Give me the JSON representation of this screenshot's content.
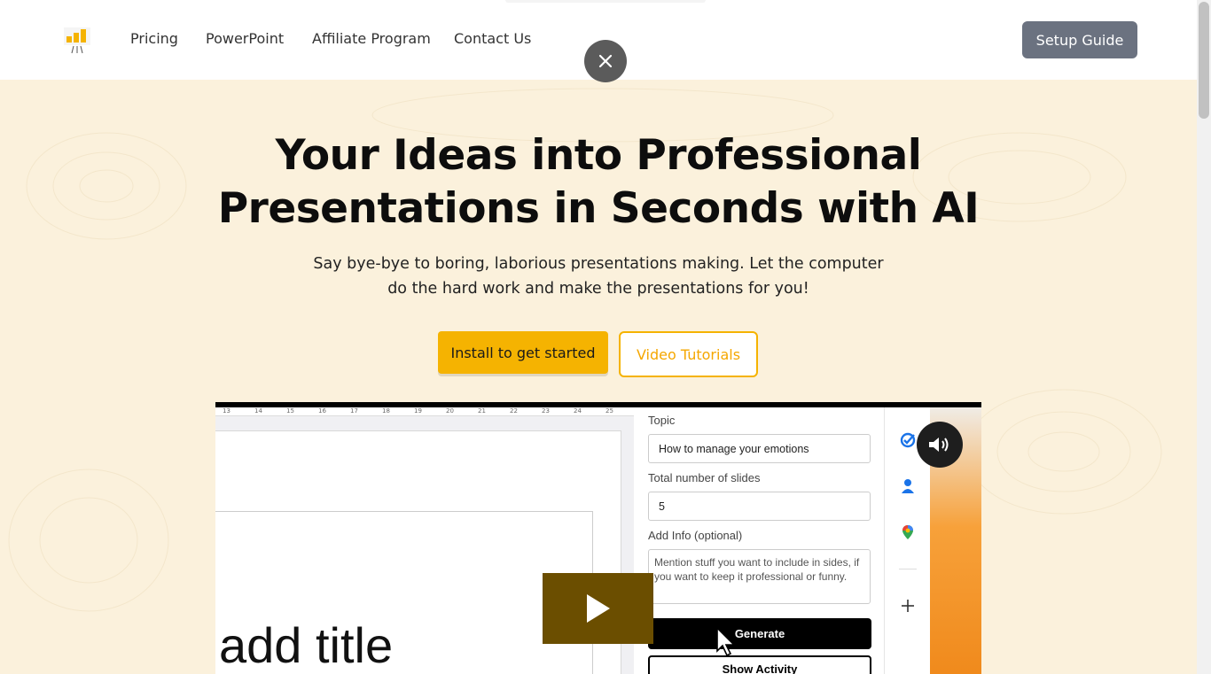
{
  "nav": {
    "items": [
      {
        "label": "Pricing"
      },
      {
        "label": "PowerPoint"
      },
      {
        "label": "Affiliate Program"
      },
      {
        "label": "Contact Us"
      }
    ],
    "setup_label": "Setup Guide"
  },
  "hero": {
    "headline_line1": "Your Ideas into Professional",
    "headline_line2": "Presentations in Seconds with AI",
    "subtext_line1": "Say bye-bye to boring, laborious presentations making. Let the computer",
    "subtext_line2": "do the hard work and make the presentations for you!",
    "install_label": "Install to get started",
    "tutorials_label": "Video Tutorials"
  },
  "video": {
    "ruler_ticks": [
      "13",
      "14",
      "15",
      "16",
      "17",
      "18",
      "19",
      "20",
      "21",
      "22",
      "23",
      "24",
      "25"
    ],
    "slide_title": "add title",
    "panel": {
      "topic_label": "Topic",
      "topic_value": "How to manage your emotions",
      "slides_label": "Total number of slides",
      "slides_value": "5",
      "info_label": "Add Info (optional)",
      "info_placeholder": "Mention stuff you want to include in sides, if you want to keep it professional or funny.",
      "generate_label": "Generate",
      "activity_label": "Show Activity"
    }
  },
  "colors": {
    "accent": "#f5b301",
    "hero_bg": "#fbf1dc",
    "setup_btn": "#6b7280"
  },
  "icons": [
    "logo-icon",
    "close-icon",
    "sound-icon",
    "play-icon",
    "tasks-icon",
    "contacts-icon",
    "maps-icon",
    "plus-icon",
    "cursor-icon"
  ]
}
